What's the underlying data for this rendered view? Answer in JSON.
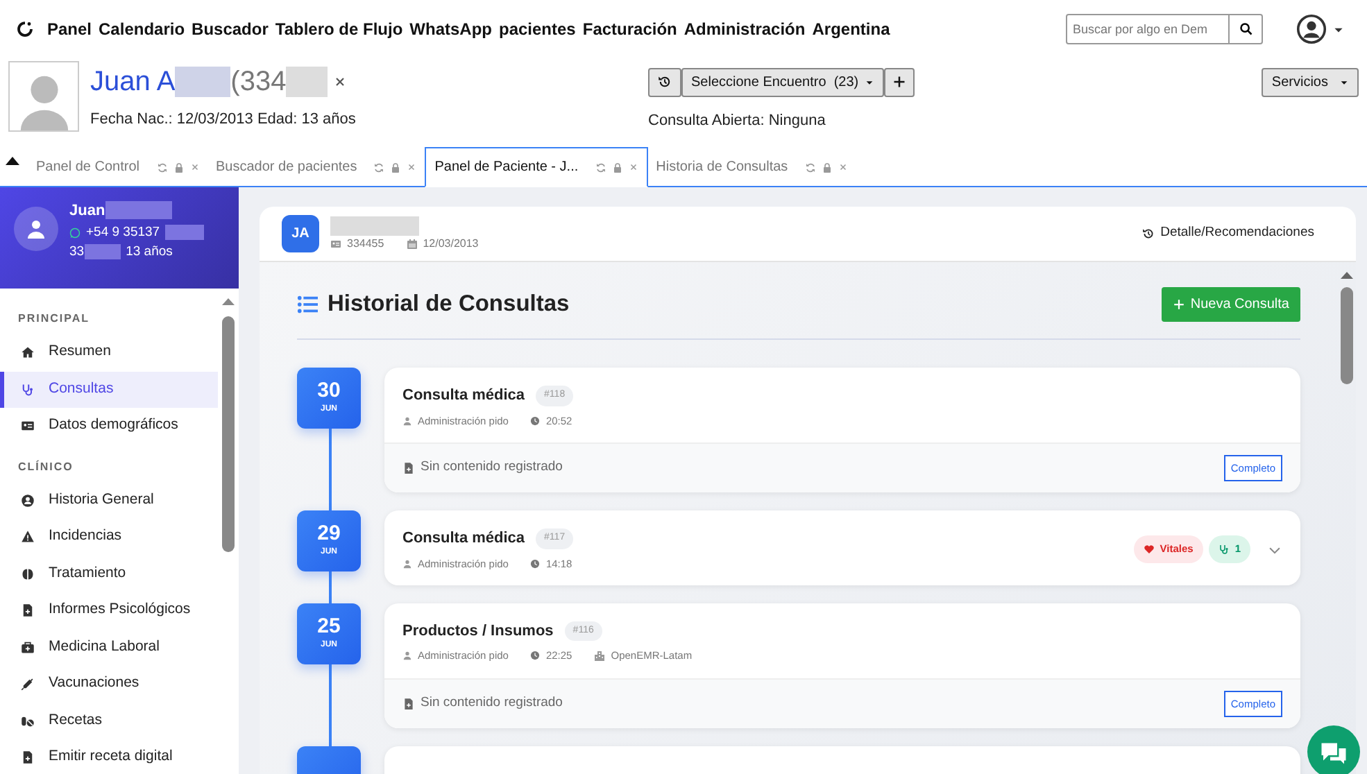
{
  "navbar": {
    "menu": [
      "Panel",
      "Calendario",
      "Buscador",
      "Tablero de Flujo",
      "WhatsApp",
      "pacientes",
      "Facturación",
      "Administración",
      "Argentina"
    ],
    "search": {
      "placeholder": "Buscar por algo en Dem"
    }
  },
  "patient_header": {
    "name": "Juan A",
    "id_partial": "(334",
    "birth_age": "Fecha Nac.: 12/03/2013 Edad: 13 años",
    "encounter_select": "Seleccione Encuentro  (23)",
    "open_consult": "Consulta Abierta: Ninguna",
    "services": "Servicios"
  },
  "tabs": [
    {
      "label": "Panel de Control",
      "selected": false
    },
    {
      "label": "Buscador de pacientes",
      "selected": false
    },
    {
      "label": "Panel de Paciente - J...",
      "selected": true
    },
    {
      "label": "Historia de Consultas",
      "selected": false
    }
  ],
  "sidebar": {
    "profile": {
      "name": "Juan",
      "phone": "+54 9 35137",
      "id_partial": "33",
      "age": "13 años"
    },
    "sections": [
      {
        "heading": "PRINCIPAL",
        "items": [
          {
            "label": "Resumen",
            "selected": false
          },
          {
            "label": "Consultas",
            "selected": true
          },
          {
            "label": "Datos demográficos",
            "selected": false
          }
        ]
      },
      {
        "heading": "CLÍNICO",
        "items": [
          {
            "label": "Historia General",
            "selected": false
          },
          {
            "label": "Incidencias",
            "selected": false
          },
          {
            "label": "Tratamiento",
            "selected": false
          },
          {
            "label": "Informes Psicológicos",
            "selected": false
          },
          {
            "label": "Medicina Laboral",
            "selected": false
          },
          {
            "label": "Vacunaciones",
            "selected": false
          },
          {
            "label": "Recetas",
            "selected": false
          },
          {
            "label": "Emitir receta digital",
            "selected": false
          }
        ]
      }
    ]
  },
  "patient_card": {
    "initials": "JA",
    "document": "334455",
    "birth_date": "12/03/2013",
    "detail_link": "Detalle/Recomendaciones"
  },
  "history": {
    "title": "Historial de Consultas",
    "new_button": "Nueva Consulta",
    "entries": [
      {
        "day": "30",
        "month": "JUN",
        "title": "Consulta médica",
        "number": "#118",
        "author": "Administración pido",
        "time": "20:52",
        "kind": "footer",
        "footer_text": "Sin contenido registrado",
        "status": "Completo"
      },
      {
        "day": "29",
        "month": "JUN",
        "title": "Consulta médica",
        "number": "#117",
        "author": "Administración pido",
        "time": "14:18",
        "kind": "collapsed",
        "badges": [
          {
            "kind": "vitals",
            "label": "Vitales"
          },
          {
            "kind": "diagnosis",
            "label": "1"
          }
        ]
      },
      {
        "day": "25",
        "month": "JUN",
        "title": "Productos / Insumos",
        "number": "#116",
        "author": "Administración pido",
        "time": "22:25",
        "facility": "OpenEMR-Latam",
        "kind": "footer",
        "footer_text": "Sin contenido registrado",
        "status": "Completo"
      }
    ]
  }
}
